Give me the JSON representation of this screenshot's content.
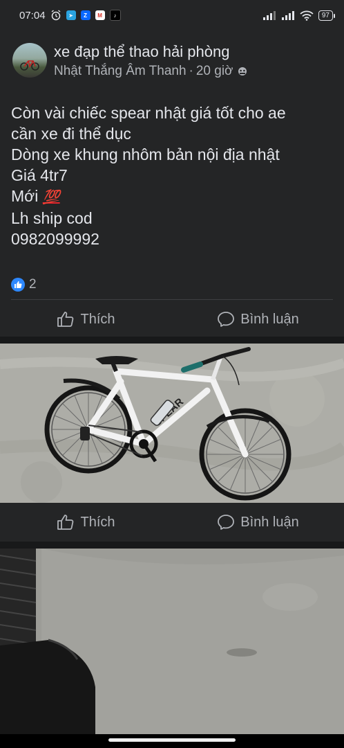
{
  "status_bar": {
    "time": "07:04",
    "battery": "97",
    "icons": [
      "alarm-icon",
      "telegram-icon",
      "zalo-icon",
      "gmail-icon",
      "tiktok-icon",
      "signal-icon",
      "signal-icon",
      "wifi-icon",
      "battery-icon"
    ]
  },
  "post": {
    "group_name": "xe đạp thể thao hải phòng",
    "author": "Nhật Thắng Âm Thanh",
    "separator": "·",
    "time_ago": "20 giờ",
    "lines": [
      "Còn vài chiếc spear nhật giá tốt cho ae",
      "cần xe đi thể dục",
      "Dòng xe khung nhôm bản nội địa nhật",
      "Giá 4tr7",
      "Mới",
      "Lh ship cod",
      "0982099992"
    ],
    "emoji_100": "💯",
    "reaction_count": "2",
    "like_label": "Thích",
    "comment_label": "Bình luận"
  },
  "photo": {
    "bike_brand": "SPEAR",
    "like_label": "Thích",
    "comment_label": "Bình luận"
  },
  "colors": {
    "background": "#18191a",
    "card": "#242526",
    "text": "#e4e6eb",
    "secondary": "#b0b3b8",
    "accent": "#2d88ff"
  }
}
